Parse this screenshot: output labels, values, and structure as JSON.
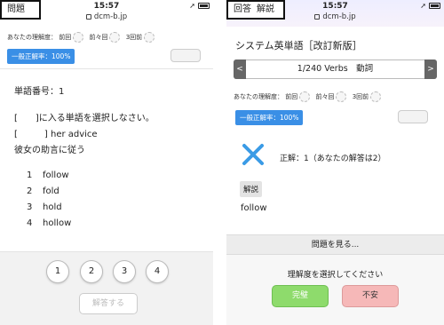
{
  "left": {
    "status": {
      "time": "15:57",
      "url": "dcm-b.jp"
    },
    "header_tab": "問題",
    "understanding": {
      "label": "あなたの理解度：",
      "prev1": "前回",
      "prev2": "前々回",
      "prev3": "3回前"
    },
    "rate_badge": "一般正解率：100%",
    "word_number": "単語番号：1",
    "instruction": "[　　]に入る単語を選択しなさい。",
    "sentence_en": "[　　　] her advice",
    "sentence_ja": "彼女の助言に従う",
    "choices": [
      {
        "num": "1",
        "text": "follow"
      },
      {
        "num": "2",
        "text": "fold"
      },
      {
        "num": "3",
        "text": "hold"
      },
      {
        "num": "4",
        "text": "hollow"
      }
    ],
    "choice_buttons": [
      "1",
      "2",
      "3",
      "4"
    ],
    "answer_button": "解答する"
  },
  "right": {
    "status": {
      "time": "15:57",
      "url": "dcm-b.jp"
    },
    "header_tabs": [
      "回答",
      "解説"
    ],
    "book_title": "システム英単語［改訂新版］",
    "nav": {
      "label": "1/240 Verbs　動詞",
      "prev": "<",
      "next": ">"
    },
    "understanding": {
      "label": "あなたの理解度：",
      "prev1": "前回",
      "prev2": "前々回",
      "prev3": "3回前"
    },
    "rate_badge": "一般正解率：100%",
    "result_text": "正解：1（あなたの解答は2）",
    "explanation_tag": "解説",
    "answer_word": "follow",
    "show_question": "問題を見る...",
    "select_prompt": "理解度を選択してください",
    "eval_buttons": {
      "perfect": "完璧",
      "unsure": "不安"
    }
  },
  "colors": {
    "badge_blue": "#3a8fe6",
    "perfect_green": "#8edb6c",
    "unsure_pink": "#f6b8b8",
    "cross_blue": "#3a9be6"
  }
}
